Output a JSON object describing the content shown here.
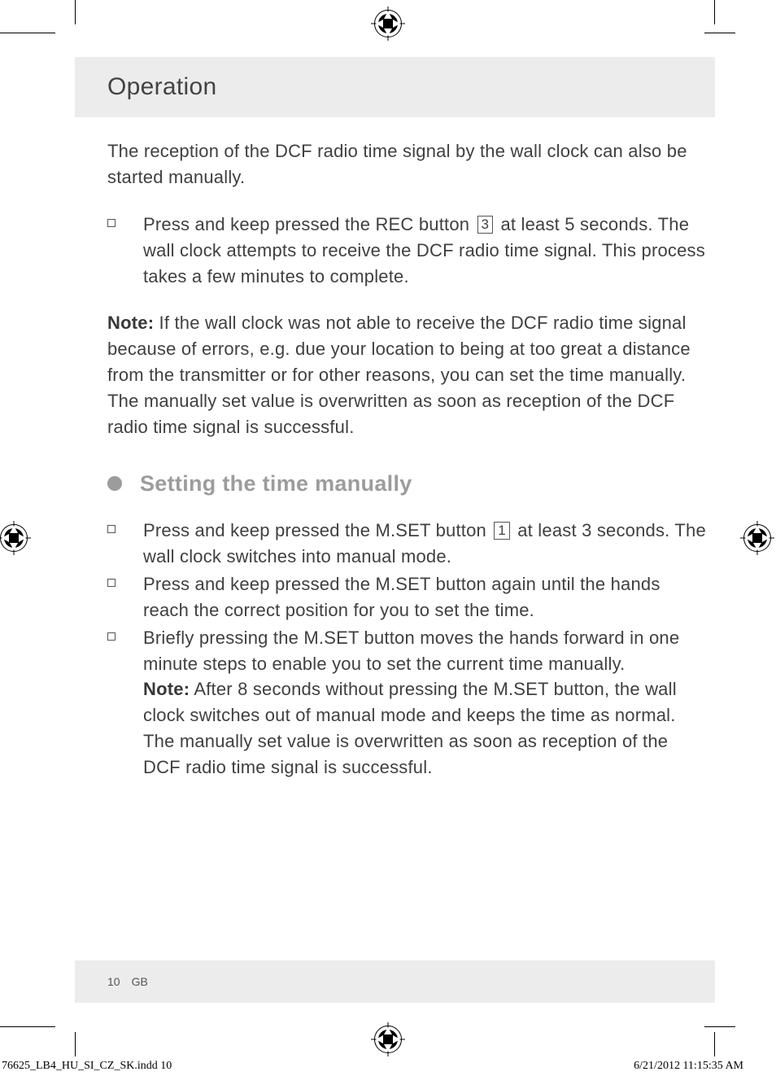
{
  "header": {
    "title": "Operation"
  },
  "intro": "The reception of the DCF radio time signal by the wall clock can also be started manually.",
  "recInstruction": {
    "pre": "Press and keep pressed the REC button ",
    "ref": "3",
    "post": " at least 5 seconds. The wall clock attempts to receive the DCF radio time signal. This process takes a few minutes to complete."
  },
  "noteLabel": "Note:",
  "noteText": " If the wall clock was not able to receive the DCF radio time signal because of errors, e.g. due your location to being at too great a distance from the transmitter or for other reasons, you can set the time manually. The manually set value is overwritten as soon as reception of the DCF radio time signal is successful.",
  "section2": {
    "title": "Setting the time manually"
  },
  "mset1": {
    "pre": "Press and keep pressed the M.SET button ",
    "ref": "1",
    "post": " at least 3 seconds. The wall clock switches into manual mode."
  },
  "mset2": "Press and keep pressed the M.SET button again until the hands reach the correct position for you to set the time.",
  "mset3": {
    "line1": "Briefly pressing the M.SET button moves the hands forward in one minute steps to enable you to set the current time manually.",
    "noteLabel": "Note:",
    "noteText": " After 8 seconds without pressing the M.SET button, the wall clock switches out of manual mode and keeps the time as normal. The manually set value is overwritten as soon as reception of the DCF radio time signal is successful."
  },
  "footer": {
    "page": "10",
    "lang": "GB"
  },
  "slug": {
    "file": "76625_LB4_HU_SI_CZ_SK.indd   10",
    "stamp": "6/21/2012   11:15:35 AM"
  }
}
